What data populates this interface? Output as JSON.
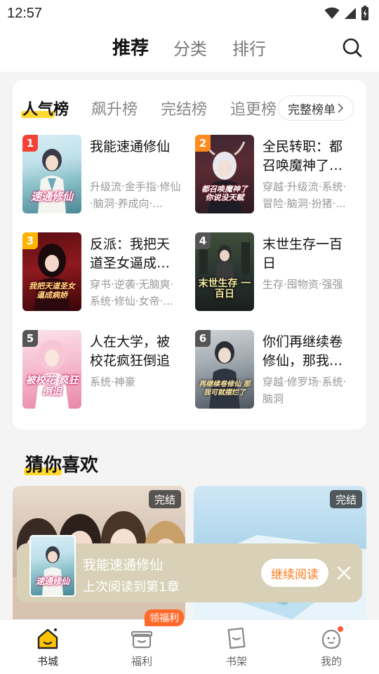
{
  "status": {
    "time": "12:57"
  },
  "top_nav": {
    "tabs": [
      {
        "label": "推荐"
      },
      {
        "label": "分类"
      },
      {
        "label": "排行"
      }
    ]
  },
  "ranking": {
    "tabs": [
      {
        "label": "人气榜"
      },
      {
        "label": "飙升榜"
      },
      {
        "label": "完结榜"
      },
      {
        "label": "追更榜"
      }
    ],
    "full_list_label": "完整榜单",
    "books": [
      {
        "rank": "1",
        "title": "我能速通修仙",
        "tags": "升级流·金手指·修仙·脑洞·养成向·...",
        "cover_text": "速通修仙",
        "badge_color": "#f44336"
      },
      {
        "rank": "2",
        "title": "全民转职：都召唤魔神了…",
        "tags": "穿越·升级流·系统·冒险·脑洞·扮猪·...",
        "cover_text": "都召唤魔神了 你说没天赋",
        "badge_color": "#ff8a1f"
      },
      {
        "rank": "3",
        "title": "反派：我把天道圣女逼成…",
        "tags": "穿书·逆袭·无脑爽·系统·修仙·女帝·...",
        "cover_text": "我把天道圣女 逼成病娇",
        "badge_color": "#ffb300"
      },
      {
        "rank": "4",
        "title": "末世生存一百日",
        "tags": "生存·囤物资·强强",
        "cover_text": "末世生存 一百日",
        "badge_color": "#555555"
      },
      {
        "rank": "5",
        "title": "人在大学，被校花疯狂倒追",
        "tags": "系统·神豪",
        "cover_text": "被校花 疯狂倒追",
        "badge_color": "#555555"
      },
      {
        "rank": "6",
        "title": "你们再继续卷修仙，那我…",
        "tags": "穿越·修罗场·系统·脑洞",
        "cover_text": "再继续卷修仙 那我可就摆烂了",
        "badge_color": "#555555"
      }
    ]
  },
  "guess": {
    "heading": "猜你喜欢",
    "cards": [
      {
        "badge": "完结"
      },
      {
        "badge": "完结"
      }
    ]
  },
  "continue_reading": {
    "title": "我能速通修仙",
    "progress": "上次阅读到第1章",
    "button": "继续阅读"
  },
  "bottom_nav": {
    "welfare_tag": "领福利",
    "items": [
      {
        "label": "书城"
      },
      {
        "label": "福利"
      },
      {
        "label": "书架"
      },
      {
        "label": "我的"
      }
    ]
  },
  "colors": {
    "accent": "#ffd92e",
    "orange": "#ff7a1a",
    "nav_active": "#ffb300"
  }
}
